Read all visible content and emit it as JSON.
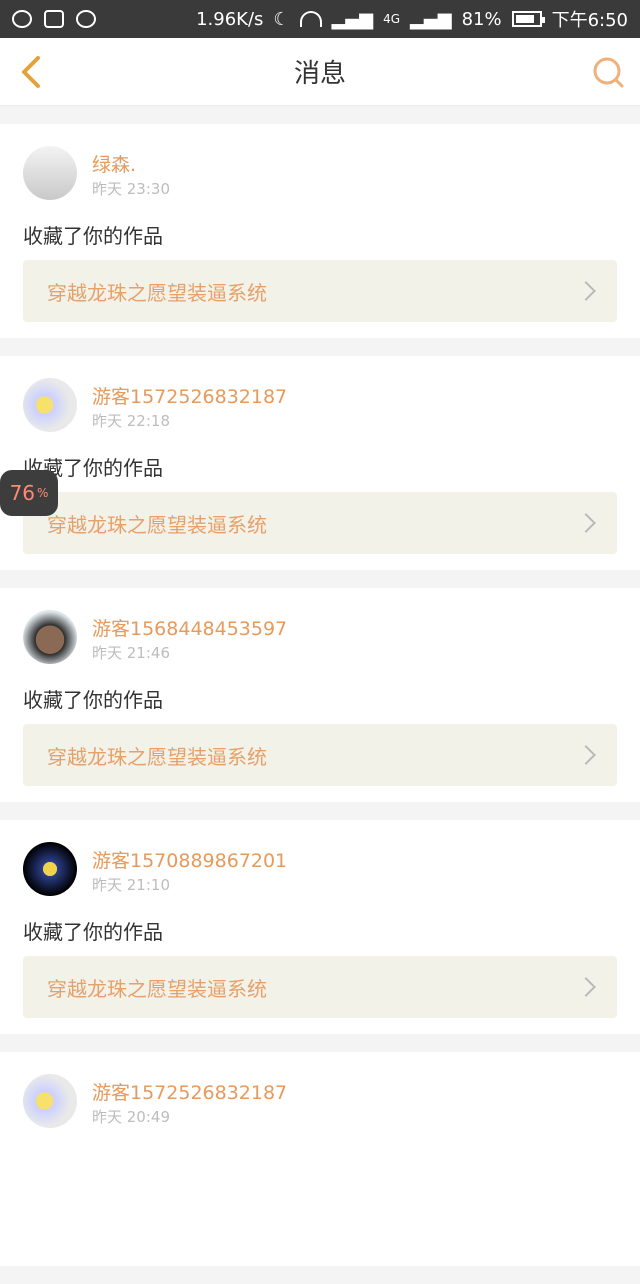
{
  "status_bar": {
    "net_speed": "1.96K/s",
    "network": "4G",
    "battery": "81%",
    "time": "下午6:50"
  },
  "header": {
    "title": "消息"
  },
  "overlay": {
    "value": "76",
    "unit": "%"
  },
  "messages": [
    {
      "name": "绿森.",
      "time": "昨天 23:30",
      "action": "收藏了你的作品",
      "work": "穿越龙珠之愿望装逼系统"
    },
    {
      "name": "游客1572526832187",
      "time": "昨天 22:18",
      "action": "收藏了你的作品",
      "work": "穿越龙珠之愿望装逼系统"
    },
    {
      "name": "游客1568448453597",
      "time": "昨天 21:46",
      "action": "收藏了你的作品",
      "work": "穿越龙珠之愿望装逼系统"
    },
    {
      "name": "游客1570889867201",
      "time": "昨天 21:10",
      "action": "收藏了你的作品",
      "work": "穿越龙珠之愿望装逼系统"
    },
    {
      "name": "游客1572526832187",
      "time": "昨天 20:49"
    }
  ],
  "colors": {
    "accent": "#e69a5b",
    "status_bar": "#3a3a3a"
  }
}
